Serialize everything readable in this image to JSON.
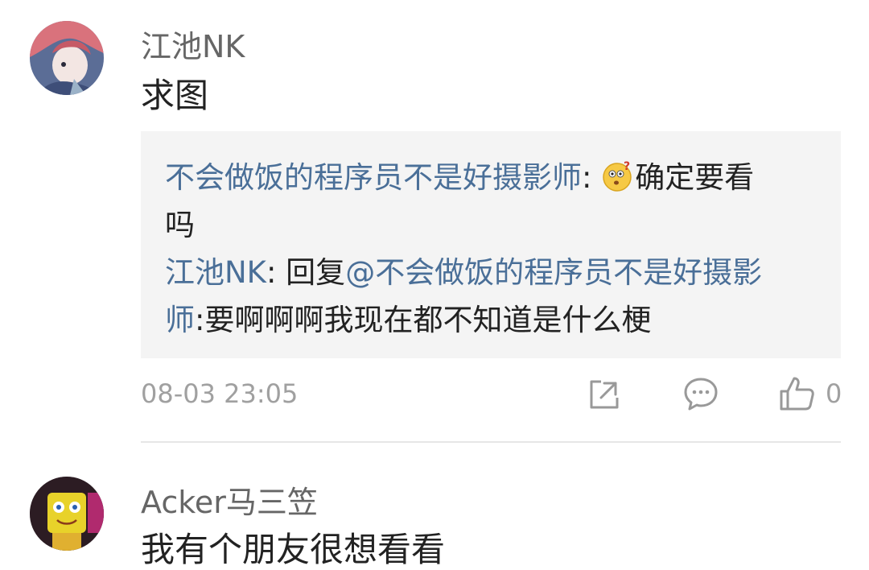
{
  "comments": [
    {
      "username": "江池NK",
      "text": "求图",
      "replies": [
        {
          "author": "不会做饭的程序员不是好摄影师",
          "separator": ": ",
          "emoji": "confused-face-emoji",
          "line1": "确定要看",
          "line2": "吗"
        },
        {
          "author": "江池NK",
          "separator": ": 回复",
          "mention_part1": "@不会做饭的程序员不是好摄影",
          "mention_part2": "师",
          "text": ":要啊啊啊我现在都不知道是什么梗"
        }
      ],
      "timestamp": "08-03 23:05",
      "like_count": "0"
    },
    {
      "username": "Acker马三笠",
      "text": "我有个朋友很想看看"
    }
  ],
  "colors": {
    "username": "#666666",
    "link": "#4a6f98",
    "text": "#222222",
    "meta": "#a0a0a0",
    "reply_bg": "#f4f4f4"
  }
}
